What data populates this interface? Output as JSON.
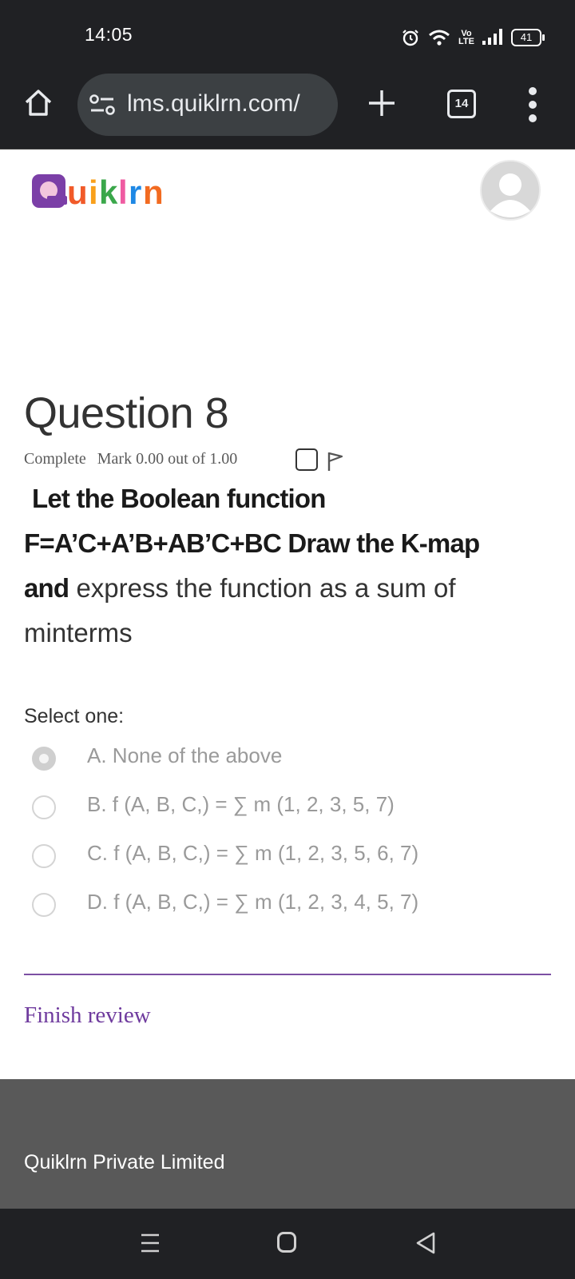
{
  "status_bar": {
    "time": "14:05",
    "volte": "Vo LTE",
    "battery": "41",
    "icons": [
      "alarm-icon",
      "wifi-icon",
      "signal-icon",
      "battery-icon"
    ]
  },
  "browser": {
    "url": "lms.quiklrn.com/",
    "tab_count": "14",
    "icons": [
      "home-icon",
      "site-settings-icon",
      "new-tab-icon",
      "tabs-icon",
      "menu-icon"
    ]
  },
  "header": {
    "brand": "Quiklrn",
    "avatar": "user-avatar-icon"
  },
  "question": {
    "title": "Question 8",
    "state": "Complete",
    "mark": "Mark 0.00 out of 1.00",
    "text_bold": "Let the Boolean function F=A’C+A’B+AB’C+BC Draw the K-map and",
    "text_plain": " express the function as a sum of minterms",
    "line1": "Let the Boolean function",
    "line2": "F=A’C+A’B+AB’C+BC Draw the K-map",
    "line3_bold": "and",
    "line3_plain": " express the function as a sum of",
    "line4": "minterms",
    "select_one": "Select one:",
    "options": [
      {
        "label": "A. None of the above",
        "selected": true
      },
      {
        "label": "B. f (A, B, C,) = ∑ m (1, 2, 3, 5, 7)",
        "selected": false
      },
      {
        "label": "C. f (A, B, C,) = ∑ m (1, 2, 3, 5, 6, 7)",
        "selected": false
      },
      {
        "label": "D. f (A, B, C,) = ∑ m (1, 2, 3, 4, 5, 7)",
        "selected": false
      }
    ]
  },
  "finish_review": "Finish review",
  "footer": {
    "company": "Quiklrn Private Limited"
  },
  "colors": {
    "accent": "#6f3b9e",
    "browser_bg": "#202124",
    "footer_bg": "#595959"
  }
}
